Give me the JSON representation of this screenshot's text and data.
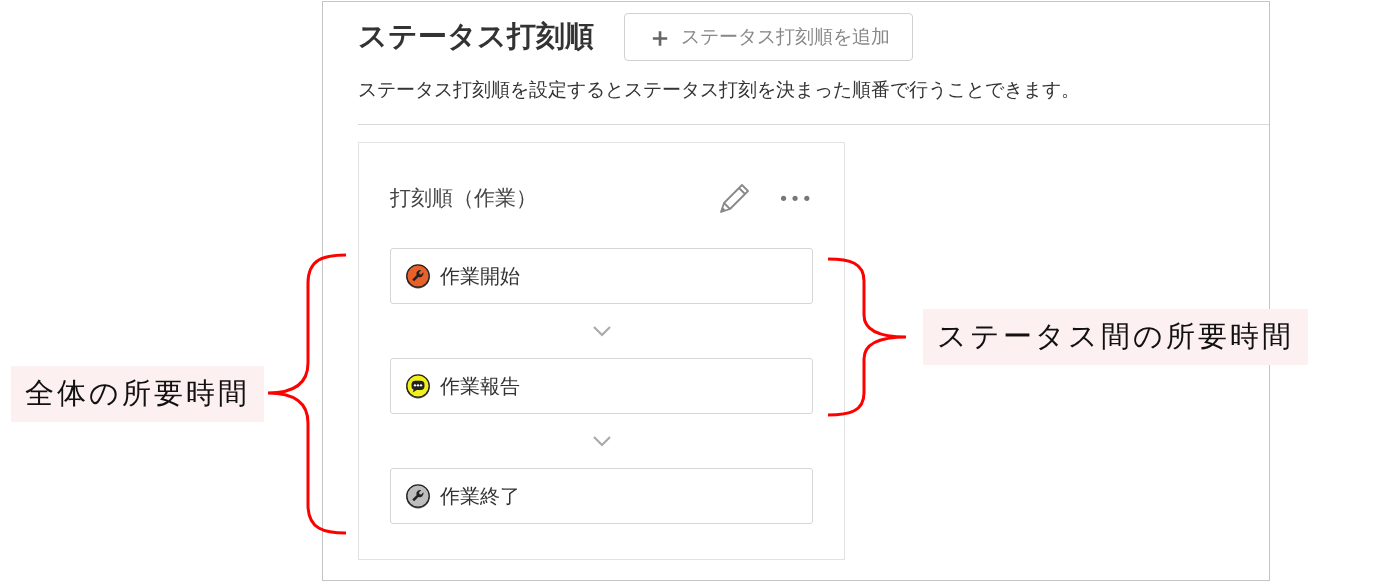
{
  "header": {
    "title": "ステータス打刻順",
    "add_button": {
      "icon": "＋",
      "label": "ステータス打刻順を追加"
    }
  },
  "description": "ステータス打刻順を設定するとステータス打刻を決まった順番で行うことできます。",
  "card": {
    "title": "打刻順（作業）",
    "more": "•••",
    "statuses": [
      {
        "label": "作業開始",
        "kind": "wrench",
        "color": "#e8602a"
      },
      {
        "label": "作業報告",
        "kind": "chat",
        "color": "#f2ef1e"
      },
      {
        "label": "作業終了",
        "kind": "wrench",
        "color": "#bdbdbd"
      }
    ]
  },
  "annotations": [
    {
      "kind": "left-brace",
      "text": "全体の所要時間"
    },
    {
      "kind": "right-brace",
      "text": "ステータス間の所要時間"
    }
  ]
}
